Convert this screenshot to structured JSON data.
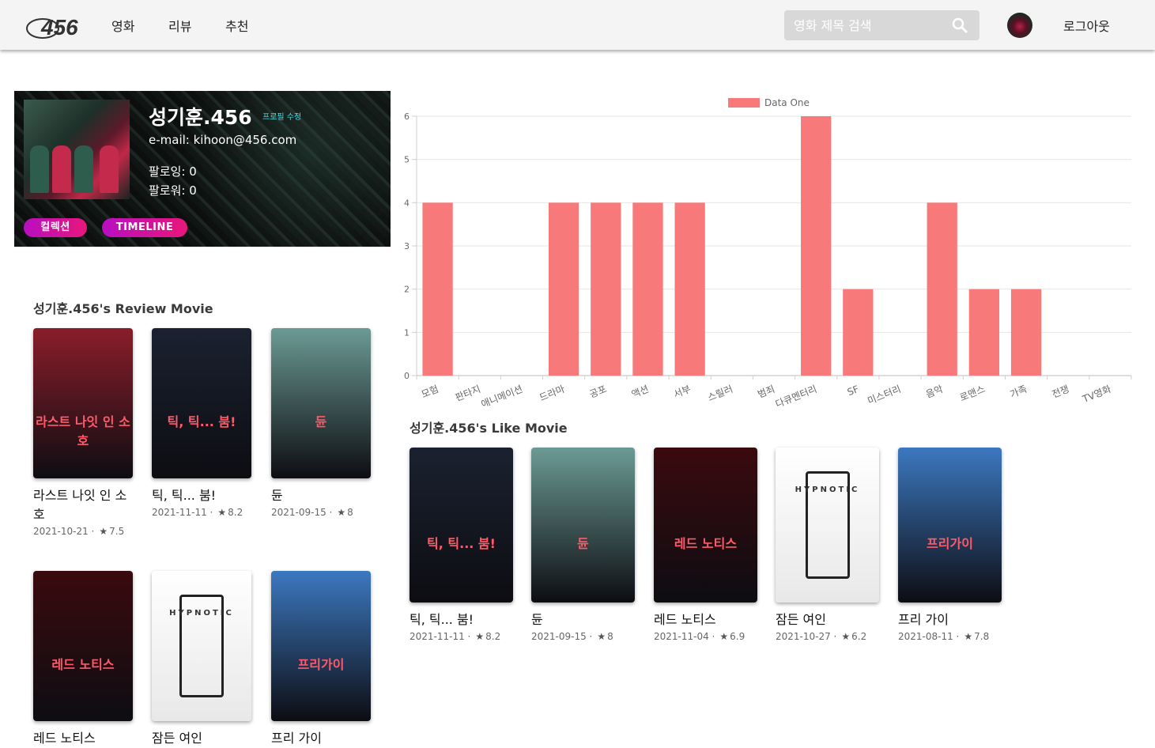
{
  "nav": {
    "logo_text": "456",
    "links": [
      "영화",
      "리뷰",
      "추천"
    ],
    "search_placeholder": "영화 제목 검색",
    "logout": "로그아웃"
  },
  "profile": {
    "name": "성기훈.456",
    "edit_label": "프로필 수정",
    "email": "e-mail: kihoon@456.com",
    "following": "팔로잉: 0",
    "followers": "팔로워: 0",
    "collection_button": "컬렉션",
    "timeline_button": "TIMELINE"
  },
  "review_section": {
    "title": "성기훈.456's Review Movie",
    "movies": [
      {
        "title": "라스트 나잇 인 소호",
        "meta": "2021-10-21 ·",
        "rating": "7.5",
        "poster_color": "#8a1d2a",
        "poster_label": "라스트 나잇 인 소호"
      },
      {
        "title": "틱, 틱... 붐!",
        "meta": "2021-11-11 ·",
        "rating": "8.2",
        "poster_color": "#1b2130",
        "poster_label": "틱, 틱... 붐!"
      },
      {
        "title": "듄",
        "meta": "2021-09-15 ·",
        "rating": "8",
        "poster_color": "#6b9a94",
        "poster_label": "듄"
      },
      {
        "title": "레드 노티스",
        "meta": "",
        "rating": "",
        "poster_color": "#3a0a0e",
        "poster_label": "레드 노티스"
      },
      {
        "title": "잠든 여인",
        "meta": "",
        "rating": "",
        "poster_color": "#f0f0f0",
        "poster_label": "HYPNOTIC"
      },
      {
        "title": "프리 가이",
        "meta": "",
        "rating": "",
        "poster_color": "#3c78c0",
        "poster_label": "프리가이"
      }
    ]
  },
  "like_section": {
    "title": "성기훈.456's Like Movie",
    "movies": [
      {
        "title": "틱, 틱... 붐!",
        "meta": "2021-11-11 ·",
        "rating": "8.2",
        "poster_color": "#1b2130",
        "poster_label": "틱, 틱... 붐!"
      },
      {
        "title": "듄",
        "meta": "2021-09-15 ·",
        "rating": "8",
        "poster_color": "#6b9a94",
        "poster_label": "듄"
      },
      {
        "title": "레드 노티스",
        "meta": "2021-11-04 ·",
        "rating": "6.9",
        "poster_color": "#3a0a0e",
        "poster_label": "레드 노티스"
      },
      {
        "title": "잠든 여인",
        "meta": "2021-10-27 ·",
        "rating": "6.2",
        "poster_color": "#f0f0f0",
        "poster_label": "HYPNOTIC"
      },
      {
        "title": "프리 가이",
        "meta": "2021-08-11 ·",
        "rating": "7.8",
        "poster_color": "#3c78c0",
        "poster_label": "프리가이"
      }
    ]
  },
  "chart_data": {
    "type": "bar",
    "categories": [
      "모험",
      "판타지",
      "애니메이션",
      "드라마",
      "공포",
      "액션",
      "서부",
      "스릴러",
      "범죄",
      "다큐멘터리",
      "SF",
      "미스터리",
      "음악",
      "로맨스",
      "가족",
      "전쟁",
      "TV영화"
    ],
    "series": [
      {
        "name": "Data One",
        "values": [
          4,
          0,
          0,
          4,
          4,
          4,
          4,
          0,
          0,
          6,
          2,
          0,
          4,
          2,
          2,
          0,
          0
        ],
        "color": "#f87979"
      }
    ],
    "ylim": [
      0,
      6
    ],
    "yticks": [
      0,
      1,
      2,
      3,
      4,
      5,
      6
    ],
    "legend": "top",
    "grid": true
  }
}
